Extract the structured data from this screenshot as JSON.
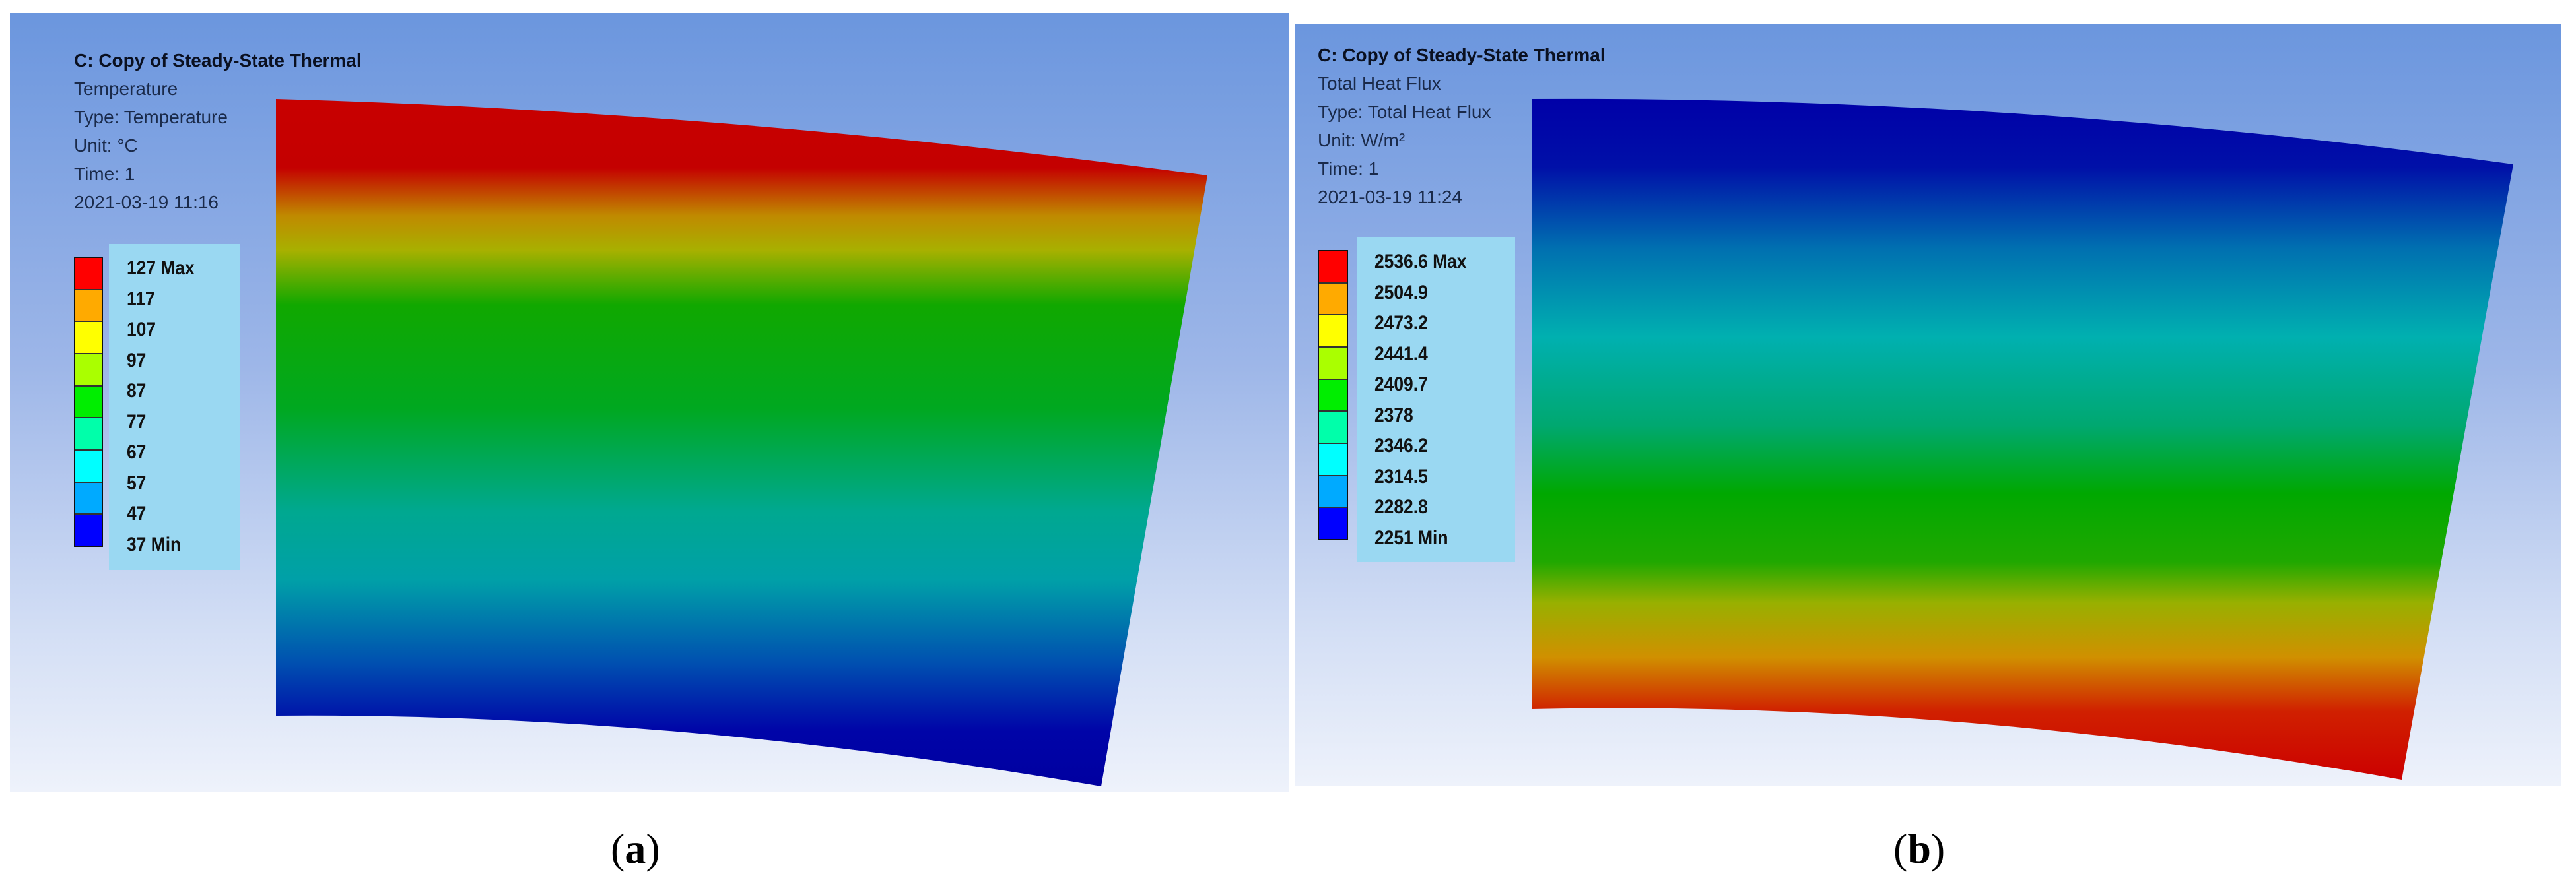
{
  "panel_a": {
    "title": "C: Copy of Steady-State Thermal",
    "lines": [
      "Temperature",
      "Type: Temperature",
      "Unit: °C",
      "Time: 1",
      "2021-03-19 11:16"
    ],
    "legend": [
      "127  Max",
      "117",
      "107",
      "97",
      "87",
      "77",
      "67",
      "57",
      "47",
      "37 Min"
    ],
    "caption_letter": "a"
  },
  "panel_b": {
    "title": "C: Copy of Steady-State Thermal",
    "lines": [
      "Total Heat Flux",
      "Type: Total Heat Flux",
      "Unit: W/m²",
      "Time: 1",
      "2021-03-19 11:24"
    ],
    "legend": [
      "2536.6  Max",
      "2504.9",
      "2473.2",
      "2441.4",
      "2409.7",
      "2378",
      "2346.2",
      "2314.5",
      "2282.8",
      "2251 Min"
    ],
    "caption_letter": "b"
  },
  "legend_colors": [
    "#ff0000",
    "#ffaa00",
    "#ffff00",
    "#aaff00",
    "#00ee00",
    "#00ffaa",
    "#00ffff",
    "#00aaff",
    "#0000ff"
  ]
}
